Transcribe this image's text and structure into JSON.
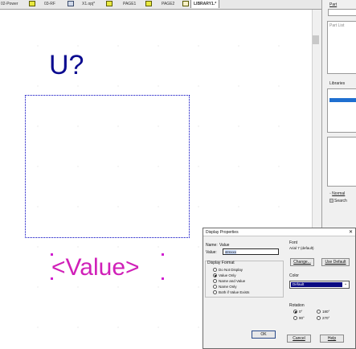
{
  "tabs": [
    "02-Power",
    "03-RF",
    "X1.opj*",
    "PAGE1",
    "PAGE2",
    "LIBRARY1.*"
  ],
  "canvas": {
    "refdes": "U?",
    "value_text": "<Value>",
    "colors": {
      "refdes": "#0b0b90",
      "value": "#d020b8",
      "box": "#0000c0"
    }
  },
  "panel": {
    "part_label": "Part",
    "part_list_label": "Part List",
    "libraries_label": "Libraries",
    "normal_label": "Normal",
    "search_label": "Search"
  },
  "dialog": {
    "title": "Display Properties",
    "close_icon": "✕",
    "name_label": "Name:",
    "name_value": "Value",
    "value_label": "Value:",
    "value_input": "stmxxx",
    "display_format_label": "Display Format",
    "formats": [
      "Do Not Display",
      "Value Only",
      "Name and Value",
      "Name Only",
      "Both if Value Exists"
    ],
    "selected_format": "Value Only",
    "font_label": "Font",
    "font_value": "Arial 7 (default)",
    "change_button": "Change...",
    "use_default_button": "Use Default",
    "color_label": "Color",
    "color_value": "Default",
    "color_swatch": "#0a0a82",
    "rotation_label": "Rotation",
    "rotations": [
      "0°",
      "180°",
      "90°",
      "270°"
    ],
    "selected_rotation": "0°",
    "ok_button": "OK",
    "cancel_button": "Cancel",
    "help_button": "Help"
  }
}
